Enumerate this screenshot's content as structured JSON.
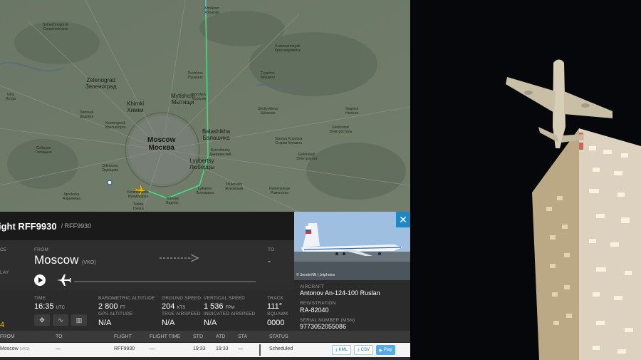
{
  "map": {
    "cities": [
      {
        "name": "Khotkovo\nХотьково",
        "size": "small"
      },
      {
        "name": "Solnechnogorsk\nСолнечногорск",
        "size": "small"
      },
      {
        "name": "Zelenograd\nЗеленоград",
        "size": "mid"
      },
      {
        "name": "Mytishchi\nМытищи",
        "size": "mid"
      },
      {
        "name": "Khimki\nХимки",
        "size": "mid"
      },
      {
        "name": "Moscow\nМосква",
        "size": "big"
      },
      {
        "name": "Balashikha\nБалашиха",
        "size": "mid"
      },
      {
        "name": "Lyubertsy\nЛюберцы",
        "size": "mid"
      },
      {
        "name": "Dedovsk\nДедовск",
        "size": "small"
      },
      {
        "name": "Krasnogorsk\nКрасногорск",
        "size": "small"
      },
      {
        "name": "Odintsovo\nОдинцово",
        "size": "small"
      },
      {
        "name": "Elektrostal\nЭлектросталь",
        "size": "small"
      },
      {
        "name": "Noginsk\nНогинск",
        "size": "small"
      },
      {
        "name": "Pushkino\nПушкино",
        "size": "small"
      },
      {
        "name": "Fryazino\nФрязино",
        "size": "small"
      },
      {
        "name": "Zhukovsky\nЖуковский",
        "size": "small"
      },
      {
        "name": "Lytkarino\nЛыткарино",
        "size": "small"
      },
      {
        "name": "Vidnoye\nВидное",
        "size": "small"
      },
      {
        "name": "Dzerzhinsky\nДзержинский",
        "size": "small"
      },
      {
        "name": "Korolyov\nКоролёв",
        "size": "small"
      },
      {
        "name": "Staraya Kupavna\nСтарая Купавна",
        "size": "small"
      },
      {
        "name": "Elektrougli\nЭлектроугли",
        "size": "small"
      },
      {
        "name": "Ramenskoye\nРаменское",
        "size": "small"
      },
      {
        "name": "Krasnoarmeysk\nКрасноармейск",
        "size": "small"
      },
      {
        "name": "Shchyolkovo\nЩёлково",
        "size": "small"
      },
      {
        "name": "Golitsyno\nГолицыно",
        "size": "small"
      },
      {
        "name": "Aprelevka\nАпрелевка",
        "size": "small"
      },
      {
        "name": "Troitsk\nТроицк",
        "size": "small"
      },
      {
        "name": "Istra\nИстра",
        "size": "small"
      },
      {
        "name": "Kommunarka\nКоммунарка",
        "size": "small"
      }
    ]
  },
  "flight": {
    "title": "ight RFF9930",
    "subtitle": "/ RFF9930",
    "from_label": "FROM",
    "to_label": "TO",
    "from_city": "Moscow",
    "from_code": "(VKO)",
    "to_city": "-",
    "left_label_1": "CE",
    "left_label_2": "LAY",
    "left_value": "4"
  },
  "stats": {
    "time_label": "TIME",
    "time_value": "16:35",
    "time_unit": "UTC",
    "baro_label": "BAROMETRIC ALTITUDE",
    "baro_value": "2 800",
    "baro_unit": "FT",
    "gps_label": "GPS ALTITUDE",
    "gps_value": "N/A",
    "gs_label": "GROUND SPEED",
    "gs_value": "204",
    "gs_unit": "KTS",
    "tas_label": "TRUE AIRSPEED",
    "tas_value": "N/A",
    "vs_label": "VERTICAL SPEED",
    "vs_value": "1 536",
    "vs_unit": "FPM",
    "ias_label": "INDICATED AIRSPEED",
    "ias_value": "N/A",
    "track_label": "TRACK",
    "track_value": "111°",
    "squawk_label": "SQUAWK",
    "squawk_value": "0000"
  },
  "aircraft": {
    "credit": "© SenderNN | Jetphotos",
    "aircraft_label": "AIRCRAFT",
    "aircraft_value": "Antonov An-124-100 Ruslan",
    "reg_label": "REGISTRATION",
    "reg_value": "RA-82040",
    "serial_label": "SERIAL NUMBER (MSN)",
    "serial_value": "9773052055086"
  },
  "table": {
    "headers": [
      "FROM",
      "TO",
      "FLIGHT",
      "FLIGHT TIME",
      "STD",
      "ATD",
      "STA",
      "STATUS"
    ],
    "row": {
      "from": "Moscow",
      "from_code": "(VKO)",
      "to": "—",
      "flight": "RFF9930",
      "flight_time": "—",
      "std": "19:33",
      "atd": "19:33",
      "sta": "—",
      "status": "Scheduled",
      "kml": "KML",
      "csv": "CSV",
      "play": "Play"
    }
  },
  "colors": {
    "track_green": "#3ee07a",
    "track_cyan": "#46d7e0",
    "aircraft_yellow": "#f2b600",
    "accent_blue": "#1e88c7"
  }
}
